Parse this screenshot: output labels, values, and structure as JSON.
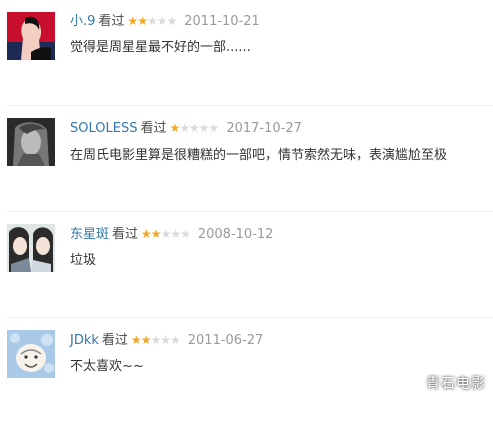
{
  "reviews": [
    {
      "user": "小.9",
      "status": "看过",
      "rating": 2,
      "date": "2011-10-21",
      "comment": "觉得是周星星最不好的一部......",
      "avatar": "woman-red-background-avatar"
    },
    {
      "user": "SOLOLESS",
      "status": "看过",
      "rating": 1,
      "date": "2017-10-27",
      "comment": "在周氏电影里算是很糟糕的一部吧，情节索然无味，表演尴尬至极",
      "avatar": "grayscale-portrait-avatar"
    },
    {
      "user": "东星斑",
      "status": "看过",
      "rating": 2,
      "date": "2008-10-12",
      "comment": "垃圾",
      "avatar": "anime-girls-avatar"
    },
    {
      "user": "JDkk",
      "status": "看过",
      "rating": 2,
      "date": "2011-06-27",
      "comment": "不太喜欢~~",
      "avatar": "cartoon-face-blue-avatar"
    }
  ],
  "watermark": "青石电影",
  "colors": {
    "username": "#3377aa",
    "star_on": "#f5a623",
    "star_off": "#dadada",
    "date": "#999999"
  }
}
